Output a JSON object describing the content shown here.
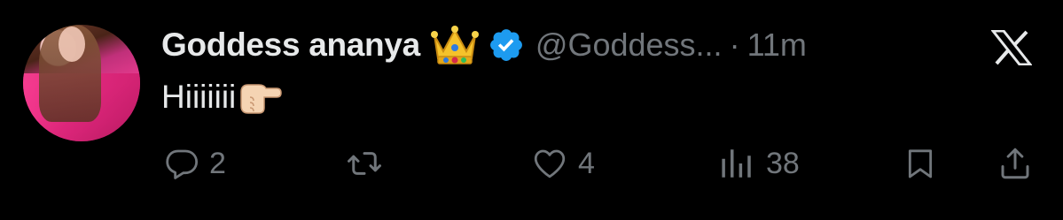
{
  "tweet": {
    "display_name": "Goddess ananya",
    "handle": "@Goddess...",
    "separator": "·",
    "time": "11m",
    "text": "Hiiiiiii",
    "badges": [
      "crown-emoji",
      "verified-badge"
    ],
    "text_emoji": "backhand-index-pointing-right"
  },
  "actions": {
    "reply_count": "2",
    "retweet_count": "",
    "like_count": "4",
    "views_count": "38"
  },
  "colors": {
    "background": "#000000",
    "primary_text": "#e7e9ea",
    "secondary_text": "#71767b",
    "verified_blue": "#1d9bf0"
  },
  "icons": {
    "reply": "reply-icon",
    "retweet": "retweet-icon",
    "like": "heart-icon",
    "views": "views-icon",
    "bookmark": "bookmark-icon",
    "share": "share-icon",
    "logo": "x-logo-icon"
  }
}
